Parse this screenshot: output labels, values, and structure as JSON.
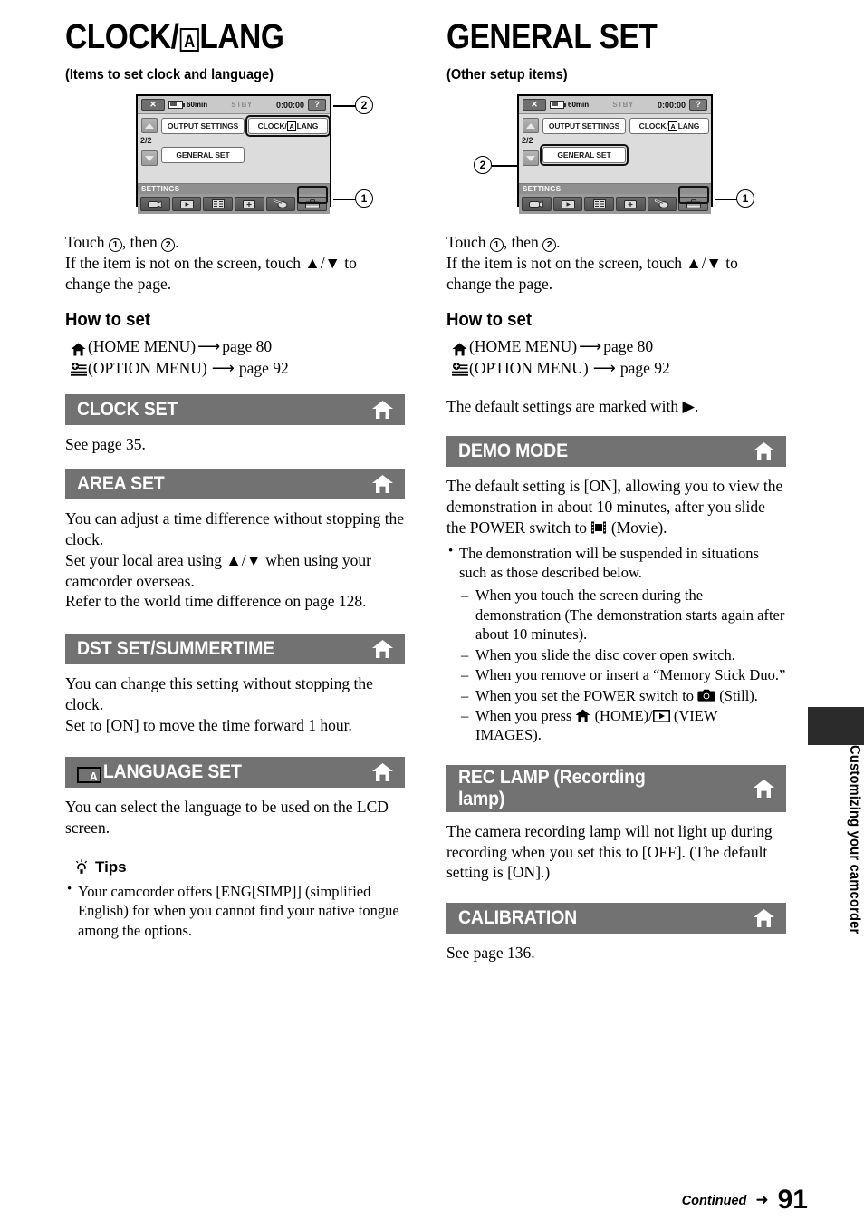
{
  "page": {
    "number": "91",
    "continued_label": "Continued",
    "continued_arrow": "➜",
    "side_tab_text": "Customizing your camcorder"
  },
  "left_column": {
    "title_prefix": "CLOCK/",
    "title_icon": "A",
    "title_suffix": "LANG",
    "subtitle": "(Items to set clock and language)",
    "lcd": {
      "status": {
        "close_icon": "✕",
        "battery_label": "60min",
        "mode": "STBY",
        "timecode": "0:00:00",
        "help_icon": "?"
      },
      "page_indicator": "2/2",
      "menu_items": [
        "OUTPUT SETTINGS",
        "CLOCK/",
        "LANG",
        "GENERAL SET"
      ],
      "item_output_settings": "OUTPUT SETTINGS",
      "item_clock_lang_pre": "CLOCK/",
      "item_clock_lang_post": "LANG",
      "item_general_set": "GENERAL SET",
      "footer_label": "SETTINGS",
      "bottom_icons": [
        "camcorder-icon",
        "view-images-icon",
        "others-list-icon",
        "manage-media-icon",
        "edit-icon",
        "settings-toolbox-icon"
      ],
      "callout_1": "1",
      "callout_2": "2"
    },
    "instructions_line1_pre": "Touch ",
    "instructions_line1_mid": ", then ",
    "instructions_line1_post": ".",
    "instructions_line2": "If the item is not on the screen, touch ▲/▼ to change the page.",
    "how_to_set_heading": "How to set",
    "home_menu_text": "(HOME MENU)",
    "home_menu_arrow": "⟶",
    "home_menu_page": "page 80",
    "option_menu_text": "(OPTION MENU)",
    "option_menu_arrow": "⟶",
    "option_menu_page": "page 92",
    "sections": [
      {
        "bar_title": "CLOCK SET",
        "body": "See page 35."
      },
      {
        "bar_title": "AREA SET",
        "body": "You can adjust a time difference without stopping the clock.\nSet your local area using ▲/▼ when using your camcorder overseas.\nRefer to the world time difference on page 128."
      },
      {
        "bar_title": "DST SET/SUMMERTIME",
        "body": "You can change this setting without stopping the clock.\nSet to [ON] to move the time forward 1 hour."
      },
      {
        "bar_title": "LANGUAGE SET",
        "bar_title_icon": "A",
        "body": "You can select the language to be used on the LCD screen."
      }
    ],
    "tips_heading": "Tips",
    "tips_items": [
      "Your camcorder offers [ENG[SIMP]] (simplified English) for when you cannot find your native tongue among the options."
    ]
  },
  "right_column": {
    "title": "GENERAL SET",
    "subtitle": "(Other setup items)",
    "lcd": {
      "status": {
        "close_icon": "✕",
        "battery_label": "60min",
        "mode": "STBY",
        "timecode": "0:00:00",
        "help_icon": "?"
      },
      "page_indicator": "2/2",
      "item_output_settings": "OUTPUT SETTINGS",
      "item_clock_lang_pre": "CLOCK/",
      "item_clock_lang_post": "LANG",
      "item_general_set": "GENERAL SET",
      "footer_label": "SETTINGS",
      "bottom_icons": [
        "camcorder-icon",
        "view-images-icon",
        "others-list-icon",
        "manage-media-icon",
        "edit-icon",
        "settings-toolbox-icon"
      ],
      "callout_1": "1",
      "callout_2": "2"
    },
    "instructions_line1_pre": "Touch ",
    "instructions_line1_mid": ", then ",
    "instructions_line1_post": ".",
    "instructions_line2": "If the item is not on the screen, touch ▲/▼ to change the page.",
    "how_to_set_heading": "How to set",
    "home_menu_text": "(HOME MENU)",
    "home_menu_arrow": "⟶",
    "home_menu_page": "page 80",
    "option_menu_text": "(OPTION MENU)",
    "option_menu_arrow": "⟶",
    "option_menu_page": "page 92",
    "default_note_pre": "The default settings are marked with ",
    "default_note_post": ".",
    "demo_mode": {
      "bar_title": "DEMO MODE",
      "body_pre": "The default setting is [ON], allowing you to view the demonstration in about 10 minutes, after you slide the POWER switch to ",
      "body_post": " (Movie).",
      "bullet": "The demonstration will be suspended in situations such as those described below.",
      "sub_items": [
        "When you touch the screen during the demonstration (The demonstration starts again after about 10 minutes).",
        "When you slide the disc cover open switch.",
        "When you remove or insert a “Memory Stick Duo.”"
      ],
      "sub_still_pre": "When you set the POWER switch to ",
      "sub_still_post": " (Still).",
      "sub_home_pre": "When you press ",
      "sub_home_mid": " (HOME)/",
      "sub_home_post": " (VIEW IMAGES)."
    },
    "rec_lamp": {
      "bar_title_line1": "REC LAMP (Recording",
      "bar_title_line2": "lamp)",
      "body": "The camera recording lamp will not light up during recording when you set this to [OFF]. (The default setting is [ON].)"
    },
    "calibration": {
      "bar_title": "CALIBRATION",
      "body": "See page 136."
    }
  },
  "colors": {
    "bar_background": "#727272",
    "bar_text": "#ffffff",
    "side_tab": "#2b2b2b",
    "lcd_background": "#d9d9d9"
  }
}
